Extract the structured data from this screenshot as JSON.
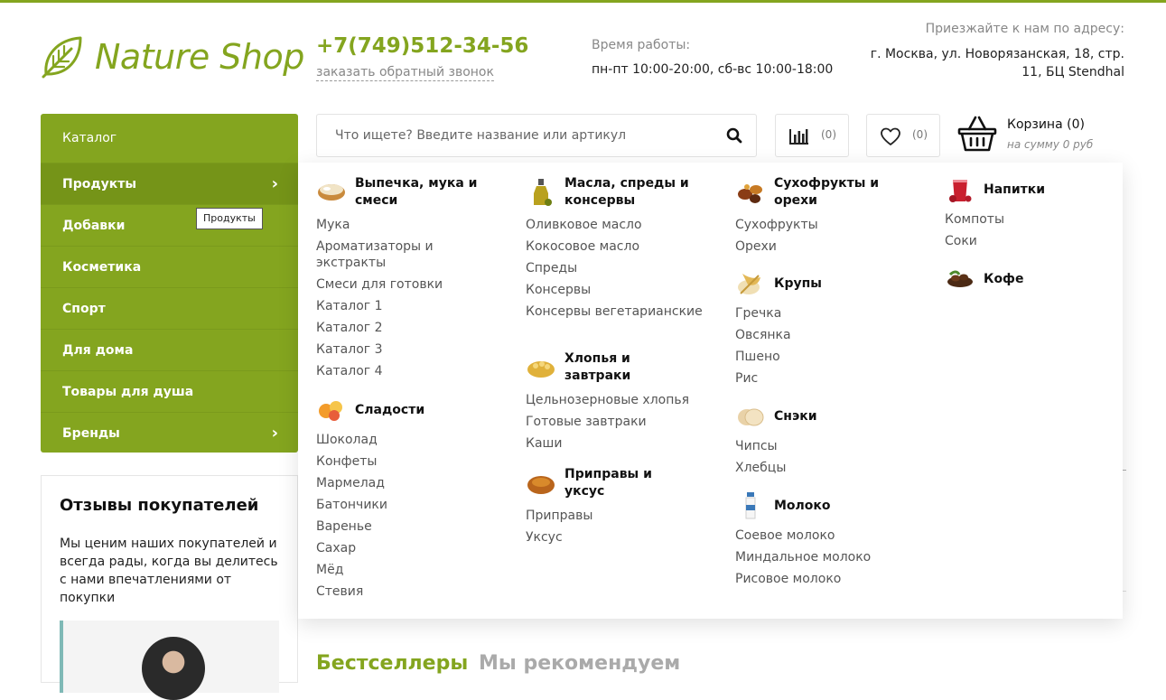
{
  "header": {
    "logo_text": "Nature Shop",
    "phone": "+7(749)512-34-56",
    "callback_label": "заказать обратный звонок",
    "hours_label": "Время работы:",
    "hours_value": "пн-пт 10:00-20:00, сб-вс 10:00-18:00",
    "address_label": "Приезжайте к нам по адресу:",
    "address_value": "г. Москва, ул. Новорязанская, 18, стр. 11, БЦ Stendhal"
  },
  "sidebar": {
    "title": "Каталог",
    "items": [
      {
        "label": "Продукты"
      },
      {
        "label": "Добавки"
      },
      {
        "label": "Косметика"
      },
      {
        "label": "Спорт"
      },
      {
        "label": "Для дома"
      },
      {
        "label": "Товары для душа"
      },
      {
        "label": "Бренды"
      }
    ],
    "tooltip": "Продукты"
  },
  "reviews": {
    "title": "Отзывы покупателей",
    "text": "Мы ценим наших покупателей и всегда рады, когда вы делитесь с нами впечатлениями от покупки"
  },
  "search": {
    "placeholder": "Что ищете? Введите название или артикул",
    "value": ""
  },
  "compare": {
    "count": "(0)"
  },
  "favorites": {
    "count": "(0)"
  },
  "cart": {
    "title": "Корзина (0)",
    "subtitle": "на сумму 0 руб"
  },
  "tabs": {
    "bestsellers": "Бестселлеры",
    "recommended": "Мы рекомендуем"
  },
  "mega": {
    "columns": [
      {
        "groups": [
          {
            "title": "Выпечка, мука и смеси",
            "icon": "flour-bowl-icon",
            "items": [
              "Мука",
              "Ароматизаторы и экстракты",
              "Смеси для готовки",
              "Каталог 1",
              "Каталог 2",
              "Каталог 3",
              "Каталог 4"
            ]
          },
          {
            "title": "Сладости",
            "icon": "sweets-icon",
            "items": [
              "Шоколад",
              "Конфеты",
              "Мармелад",
              "Батончики",
              "Варенье",
              "Сахар",
              "Мёд",
              "Стевия"
            ]
          }
        ]
      },
      {
        "groups": [
          {
            "title": "Масла, спреды и консервы",
            "icon": "olive-oil-icon",
            "items": [
              "Оливковое масло",
              "Кокосовое масло",
              "Спреды",
              "Консервы",
              "Консервы вегетарианские"
            ]
          },
          {
            "title": "Хлопья и завтраки",
            "icon": "cereal-icon",
            "items": [
              "Цельнозерновые хлопья",
              "Готовые завтраки",
              "Каши"
            ]
          },
          {
            "title": "Приправы и уксус",
            "icon": "spices-icon",
            "items": [
              "Приправы",
              "Уксус"
            ]
          }
        ]
      },
      {
        "groups": [
          {
            "title": "Сухофрукты и орехи",
            "icon": "dried-fruits-icon",
            "items": [
              "Сухофрукты",
              "Орехи"
            ]
          },
          {
            "title": "Крупы",
            "icon": "grains-icon",
            "items": [
              "Гречка",
              "Овсянка",
              "Пшено",
              "Рис"
            ]
          },
          {
            "title": "Снэки",
            "icon": "snacks-icon",
            "items": [
              "Чипсы",
              "Хлебцы"
            ]
          },
          {
            "title": "Молоко",
            "icon": "milk-bottle-icon",
            "items": [
              "Соевое молоко",
              "Миндальное молоко",
              "Рисовое молоко"
            ]
          }
        ]
      },
      {
        "groups": [
          {
            "title": "Напитки",
            "icon": "drink-glass-icon",
            "items": [
              "Компоты",
              "Соки"
            ]
          },
          {
            "title": "Кофе",
            "icon": "coffee-beans-icon",
            "items": []
          }
        ]
      }
    ]
  },
  "colors": {
    "accent": "#84a51f",
    "accent_dark": "#759418"
  }
}
